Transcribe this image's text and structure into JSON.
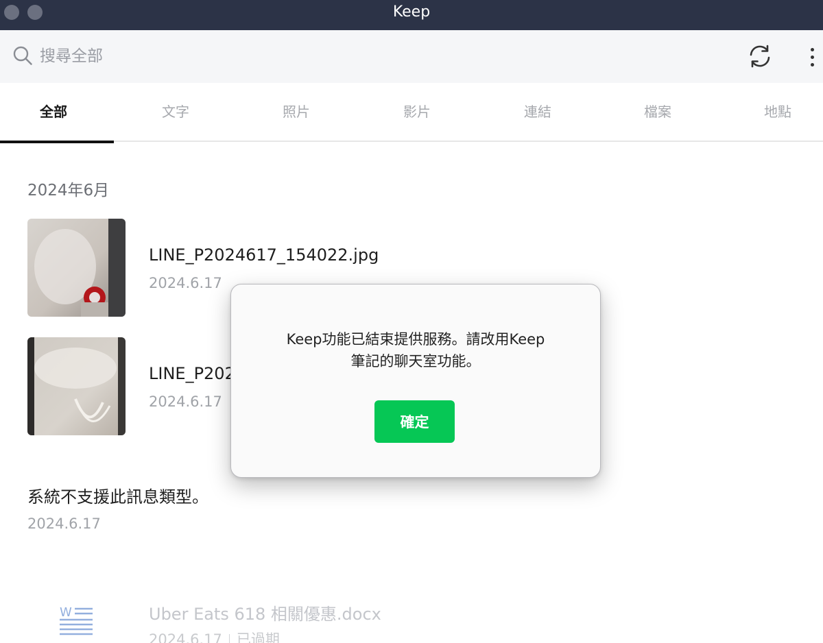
{
  "window": {
    "title": "Keep"
  },
  "search": {
    "placeholder": "搜尋全部"
  },
  "toolbar": {
    "refresh_icon": "refresh-icon",
    "more_icon": "more-vertical-icon"
  },
  "tabs": [
    {
      "label": "全部",
      "active": true
    },
    {
      "label": "文字"
    },
    {
      "label": "照片"
    },
    {
      "label": "影片"
    },
    {
      "label": "連結"
    },
    {
      "label": "檔案"
    },
    {
      "label": "地點"
    }
  ],
  "content": {
    "section_month": "2024年6月",
    "items": [
      {
        "name": "LINE_P2024617_154022.jpg",
        "date": "2024.6.17"
      },
      {
        "name": "LINE_P202",
        "date": "2024.6.17"
      }
    ],
    "unsupported": {
      "text": "系統不支援此訊息類型。",
      "date": "2024.6.17"
    },
    "docx": {
      "name": "Uber Eats 618 相關優惠.docx",
      "date": "2024.6.17",
      "status": "已過期"
    }
  },
  "dialog": {
    "message_line1": "Keep功能已結束提供服務。請改用Keep",
    "message_line2": "筆記的聊天室功能。",
    "ok_label": "確定"
  },
  "colors": {
    "titlebar": "#2c3347",
    "accent": "#06c755"
  }
}
